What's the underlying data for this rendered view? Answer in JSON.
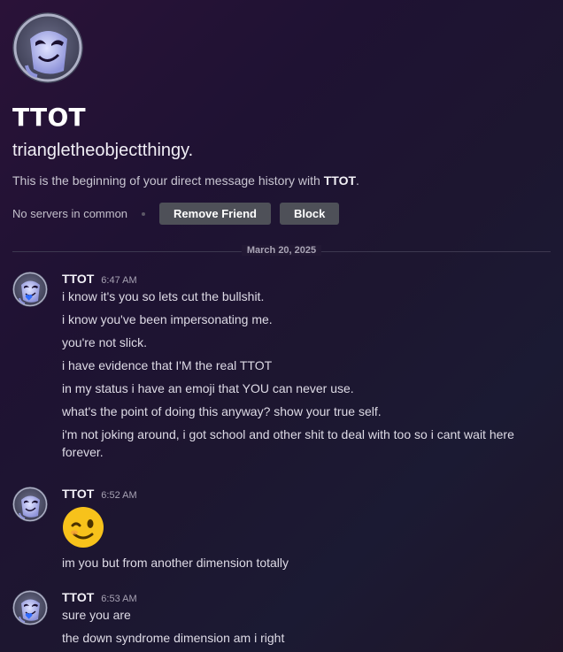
{
  "profile": {
    "display_name": "TTOT",
    "username": "triangletheobjectthingy.",
    "intro_prefix": "This is the beginning of your direct message history with ",
    "intro_name": "TTOT",
    "intro_suffix": ".",
    "servers_text": "No servers in common",
    "remove_friend_label": "Remove Friend",
    "block_label": "Block"
  },
  "date_divider": "March 20, 2025",
  "messages": [
    {
      "author": "TTOT",
      "time": "6:47 AM",
      "lines": [
        "i know it's you so lets cut the bullshit.",
        "i know you've been impersonating me.",
        "you're not slick.",
        "i have evidence that I'M the real TTOT",
        "in my status i have an emoji that YOU can never use.",
        "what's the point of doing this anyway? show your true self.",
        "i'm not joking around, i got school and other shit to deal with too so i cant wait here forever."
      ]
    },
    {
      "author": "TTOT",
      "time": "6:52 AM",
      "emoji": "winking-face",
      "lines": [
        "im you but from another dimension totally"
      ]
    },
    {
      "author": "TTOT",
      "time": "6:53 AM",
      "lines": [
        "sure you are",
        "the down syndrome dimension am i right"
      ]
    }
  ],
  "colors": {
    "button_bg": "#4e5058",
    "heart": "#2f6bff",
    "emoji_yellow": "#f7c21b"
  }
}
